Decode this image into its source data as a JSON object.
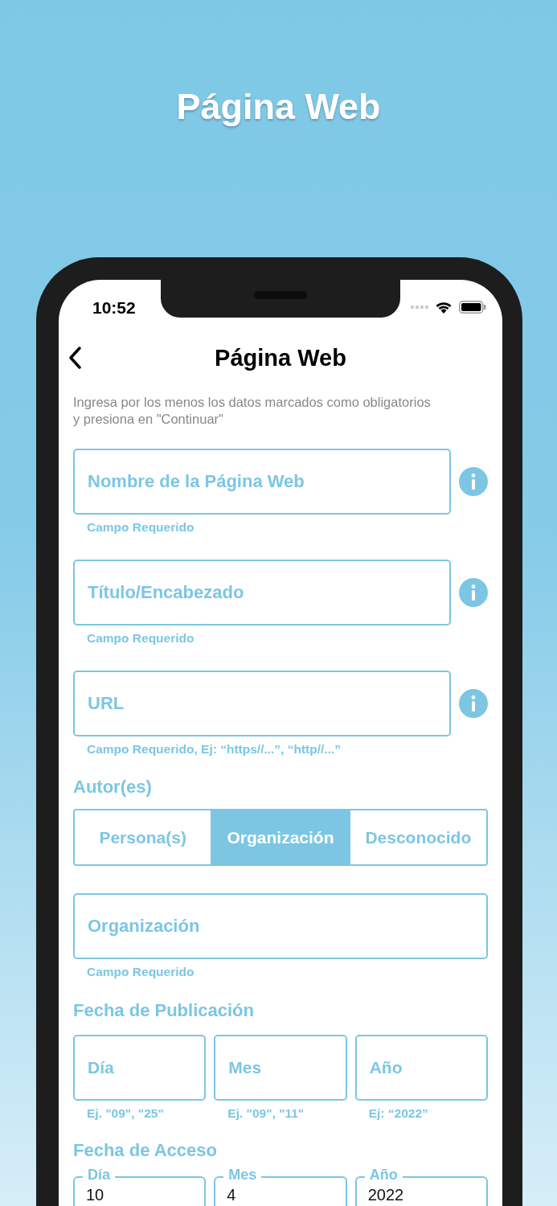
{
  "headline": "Página Web",
  "status_bar": {
    "time": "10:52"
  },
  "nav": {
    "title": "Página Web"
  },
  "instructions": "Ingresa por los menos los datos marcados como obligatorios y presiona en \"Continuar\"",
  "fields": [
    {
      "placeholder": "Nombre de la Página Web",
      "helper": "Campo Requerido",
      "has_info": true
    },
    {
      "placeholder": "Título/Encabezado",
      "helper": "Campo Requerido",
      "has_info": true
    },
    {
      "placeholder": "URL",
      "helper": "Campo Requerido, Ej: “https//...”, “http//...”",
      "has_info": true
    }
  ],
  "authors": {
    "label": "Autor(es)",
    "segments": [
      {
        "label": "Persona(s)",
        "selected": false
      },
      {
        "label": "Organización",
        "selected": true
      },
      {
        "label": "Desconocido",
        "selected": false
      }
    ],
    "field": {
      "placeholder": "Organización",
      "helper": "Campo Requerido",
      "has_info": false
    }
  },
  "publication_date": {
    "label": "Fecha de Publicación",
    "fields": [
      {
        "placeholder": "Día",
        "helper": "Ej. \"09\", \"25\""
      },
      {
        "placeholder": "Mes",
        "helper": "Ej. \"09\", \"11\""
      },
      {
        "placeholder": "Año",
        "helper": "Ej: “2022”"
      }
    ]
  },
  "access_date": {
    "label": "Fecha de Acceso",
    "fields": [
      {
        "label": "Día",
        "value": "10"
      },
      {
        "label": "Mes",
        "value": "4"
      },
      {
        "label": "Año",
        "value": "2022"
      }
    ]
  }
}
